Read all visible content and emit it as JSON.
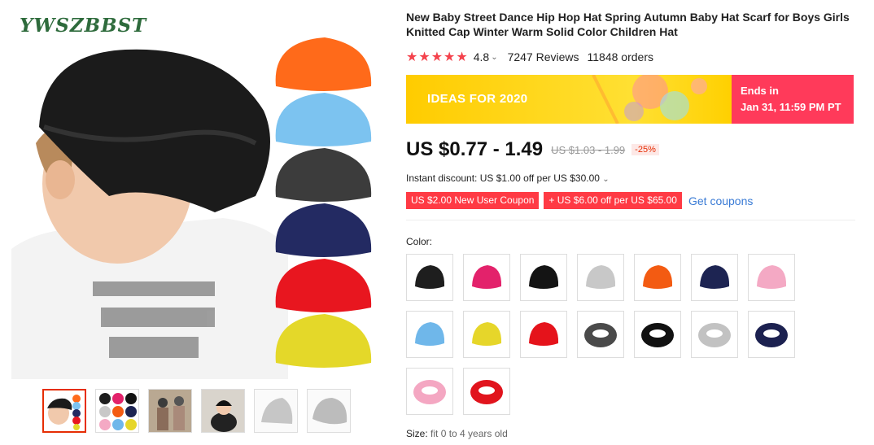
{
  "brand": "YWSZBBST",
  "product": {
    "title": "New Baby Street Dance Hip Hop Hat Spring Autumn Baby Hat Scarf for Boys Girls Knitted Cap Winter Warm Solid Color Children Hat",
    "rating": "4.8",
    "reviews": "7247 Reviews",
    "orders": "11848 orders"
  },
  "promo_banner": {
    "label": "IDEAS FOR 2020",
    "ends_label": "Ends in",
    "ends_time": "Jan 31, 11:59 PM PT",
    "colors": {
      "left": "#ffcc00",
      "right": "#ff3a5a"
    }
  },
  "pricing": {
    "price": "US $0.77 - 1.49",
    "original_price": "US $1.03 - 1.99",
    "discount": "-25%",
    "instant_discount": "Instant discount: US $1.00 off per US $30.00"
  },
  "coupons": {
    "items": [
      "US $2.00 New User Coupon",
      "+ US $6.00 off per US $65.00"
    ],
    "get_link": "Get coupons"
  },
  "color": {
    "label": "Color:",
    "options": [
      {
        "kind": "hat",
        "color": "#1e1e1e"
      },
      {
        "kind": "hat",
        "color": "#e3226b"
      },
      {
        "kind": "hat",
        "color": "#141414"
      },
      {
        "kind": "hat",
        "color": "#c8c8c8"
      },
      {
        "kind": "hat",
        "color": "#f35b12"
      },
      {
        "kind": "hat",
        "color": "#1d2452"
      },
      {
        "kind": "hat",
        "color": "#f4a9c4"
      },
      {
        "kind": "hat",
        "color": "#6fb7ea"
      },
      {
        "kind": "hat",
        "color": "#e6d62a"
      },
      {
        "kind": "hat",
        "color": "#e5131b"
      },
      {
        "kind": "scarf",
        "color": "#4a4a4a"
      },
      {
        "kind": "scarf",
        "color": "#111111"
      },
      {
        "kind": "scarf",
        "color": "#c2c2c2"
      },
      {
        "kind": "scarf",
        "color": "#1c2150"
      },
      {
        "kind": "scarf",
        "color": "#f4a7c2"
      },
      {
        "kind": "scarf",
        "color": "#e1141d"
      }
    ]
  },
  "size": {
    "label": "Size:",
    "value": "fit 0 to 4 years old"
  },
  "gallery": {
    "hat_stack_colors": [
      "#ff6a1a",
      "#7cc3f0",
      "#3c3c3c",
      "#232a62",
      "#e8161f",
      "#e4d829"
    ]
  },
  "colors": {
    "accent": "#e62e04",
    "star": "#f4424c",
    "link": "#3a7bd5"
  }
}
